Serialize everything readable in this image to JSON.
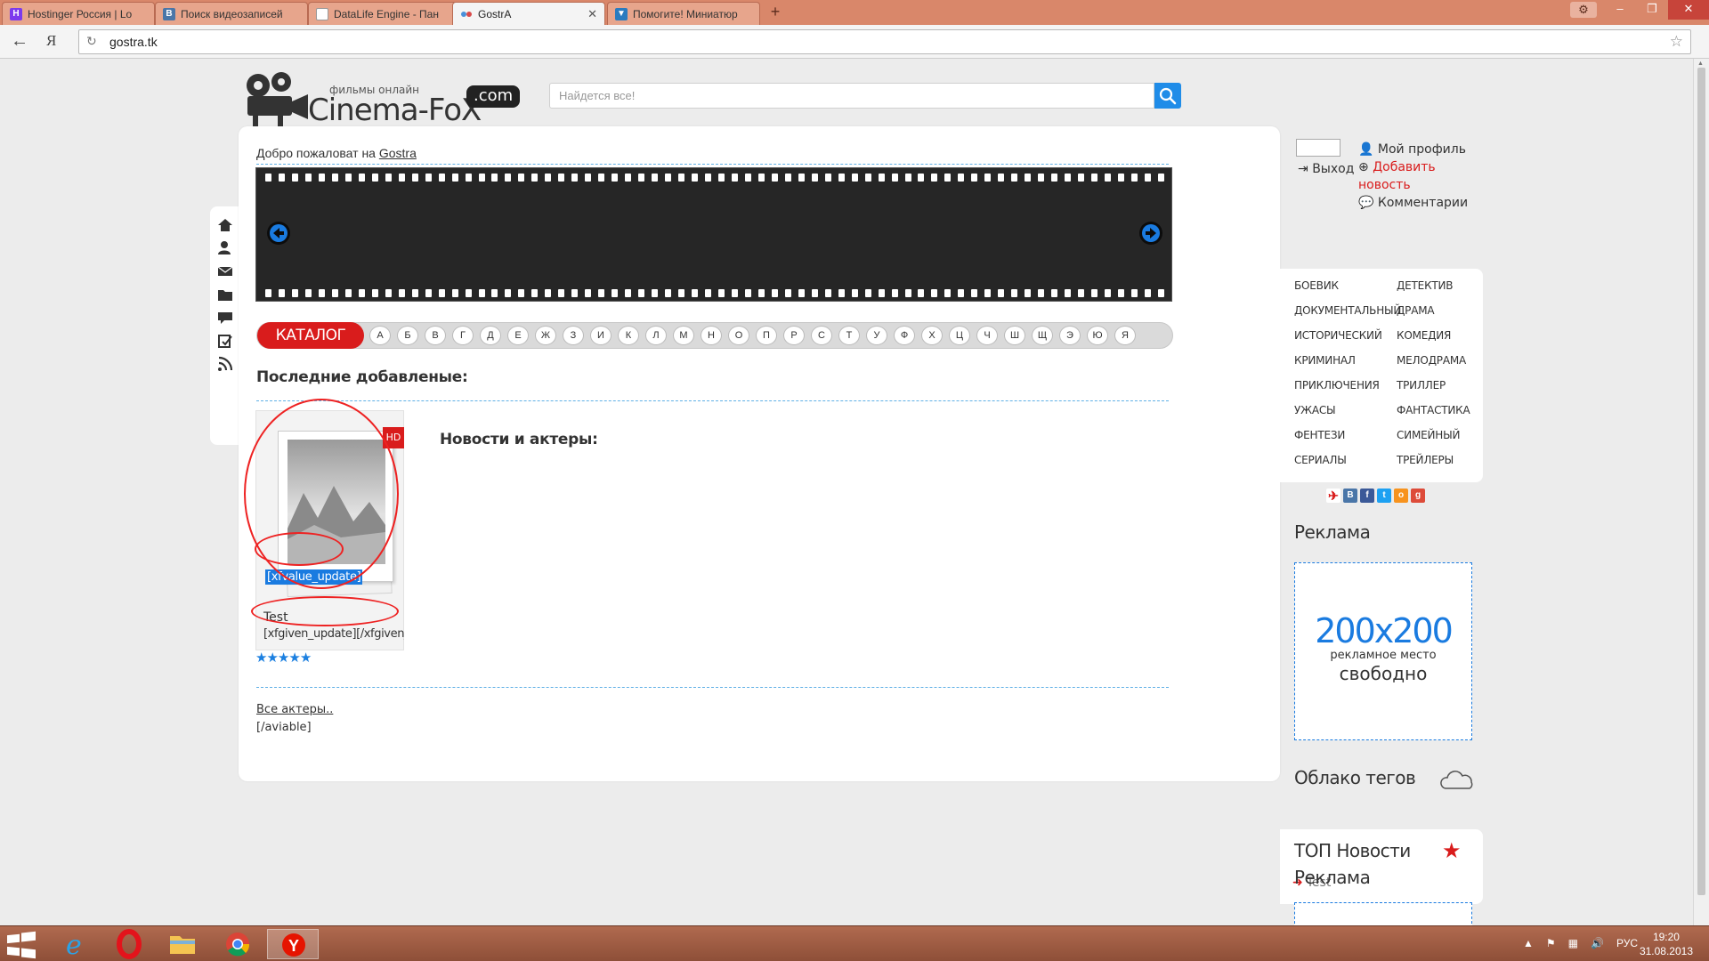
{
  "browser": {
    "tabs": [
      {
        "label": "Hostinger Россия | Lo",
        "favicon": "H",
        "color": "#7c3aed"
      },
      {
        "label": "Поиск видеозаписей",
        "favicon": "B",
        "color": "#4a76a8"
      },
      {
        "label": "DataLife Engine - Пан",
        "favicon": "",
        "color": "#ffffff"
      },
      {
        "label": "GostrA",
        "favicon": "",
        "color": "#ffffff"
      },
      {
        "label": "Помогите! Миниатюр",
        "favicon": "",
        "color": "#2a7bbf"
      }
    ],
    "active_tab": 3,
    "new_tab": "+",
    "yandex_letter": "Я",
    "url": "gostra.tk"
  },
  "site": {
    "logo_small": "фильмы онлайн",
    "logo_name": "Cinema-FoX",
    "logo_domain": ".com",
    "search_placeholder": "Найдется все!",
    "welcome_text": "Добро пожаловат на ",
    "welcome_link": "Gostra",
    "catalog_label": "КАТАЛОГ",
    "letters": [
      "А",
      "Б",
      "В",
      "Г",
      "Д",
      "Е",
      "Ж",
      "З",
      "И",
      "К",
      "Л",
      "М",
      "Н",
      "О",
      "П",
      "Р",
      "С",
      "Т",
      "У",
      "Ф",
      "Х",
      "Ц",
      "Ч",
      "Ш",
      "Щ",
      "Э",
      "Ю",
      "Я"
    ],
    "latest_title": "Последние добавленые:",
    "movie": {
      "badge": "HD",
      "xf_tag": "[xfvalue_update]",
      "title": "Test",
      "given": "[xfgiven_update][/xfgiven_up",
      "rating_stars": 5
    },
    "news_actors_title": "Новости и актеры:",
    "all_actors": "Все актеры..",
    "aviable": "[/aviable]"
  },
  "user_panel": {
    "exit": "Выход",
    "profile": "Мой профиль",
    "add_news": "Добавить новость",
    "comments": "Комментарии"
  },
  "genres_left": [
    "БОЕВИК",
    "ДОКУМЕНТАЛЬНЫЙ",
    "ИСТОРИЧЕСКИЙ",
    "КРИМИНАЛ",
    "ПРИКЛЮЧЕНИЯ",
    "УЖАСЫ",
    "ФЕНТЕЗИ",
    "СЕРИАЛЫ"
  ],
  "genres_right": [
    "ДЕТЕКТИВ",
    "ДРАМА",
    "КОМЕДИЯ",
    "МЕЛОДРАМА",
    "ТРИЛЛЕР",
    "ФАНТАСТИКА",
    "СИМЕЙНЫЙ",
    "ТРЕЙЛЕРЫ"
  ],
  "widgets": {
    "ad_title": "Реклама",
    "ad_size": "200x200",
    "ad_line1": "рекламное место",
    "ad_line2": "свободно",
    "tags_title": "Облако тегов",
    "top_title": "ТОП Новости",
    "top_item": "Test",
    "ad2_title": "Реклама"
  },
  "taskbar": {
    "lang": "РУС",
    "time": "19:20",
    "date": "31.08.2013"
  },
  "colors": {
    "accent_red": "#d91c1c",
    "accent_blue": "#1a7be0",
    "chrome_orange": "#d9876a"
  }
}
